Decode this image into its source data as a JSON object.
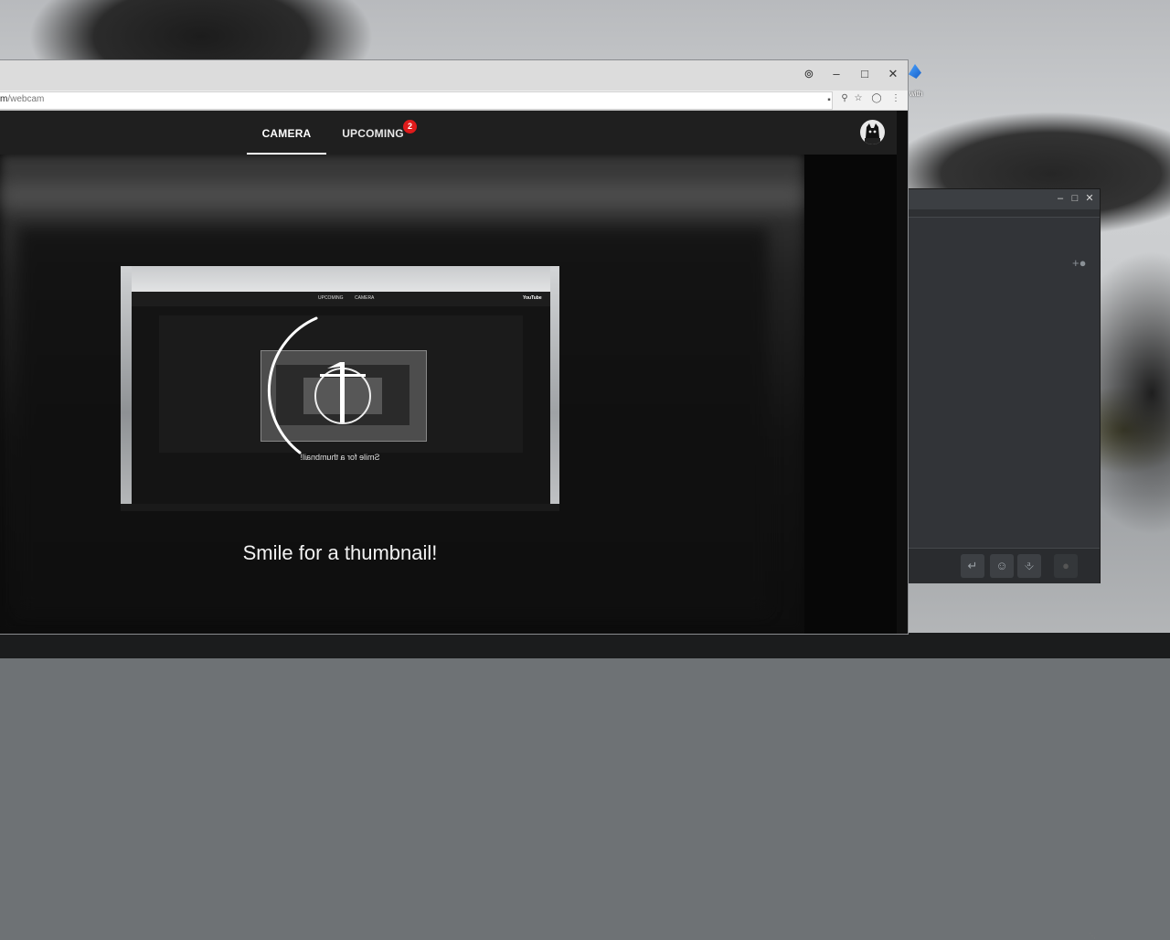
{
  "browser": {
    "url_prefix": "m",
    "url_path": "/webcam",
    "window_controls": {
      "account": "⊚",
      "minimize": "–",
      "maximize": "□",
      "close": "✕"
    },
    "address_icons": [
      "camera-icon",
      "zoom-icon",
      "star-icon",
      "extension-icon",
      "menu-icon"
    ]
  },
  "nav": {
    "tabs": [
      {
        "label": "CAMERA",
        "active": true
      },
      {
        "label": "UPCOMING",
        "active": false
      }
    ],
    "upcoming_badge": "2"
  },
  "preview": {
    "nested_caption": "Smile for a thumbnail!",
    "nested_tab_camera": "CAMERA",
    "nested_tab_upcoming": "UPCOMING",
    "nested_logo": "YouTube",
    "countdown": "1"
  },
  "caption": "Smile for a thumbnail!",
  "desktop_icon_label": "with",
  "colors": {
    "nav_bg": "#1f1f1f",
    "badge": "#e01b1b",
    "chat_bg": "#323438"
  }
}
